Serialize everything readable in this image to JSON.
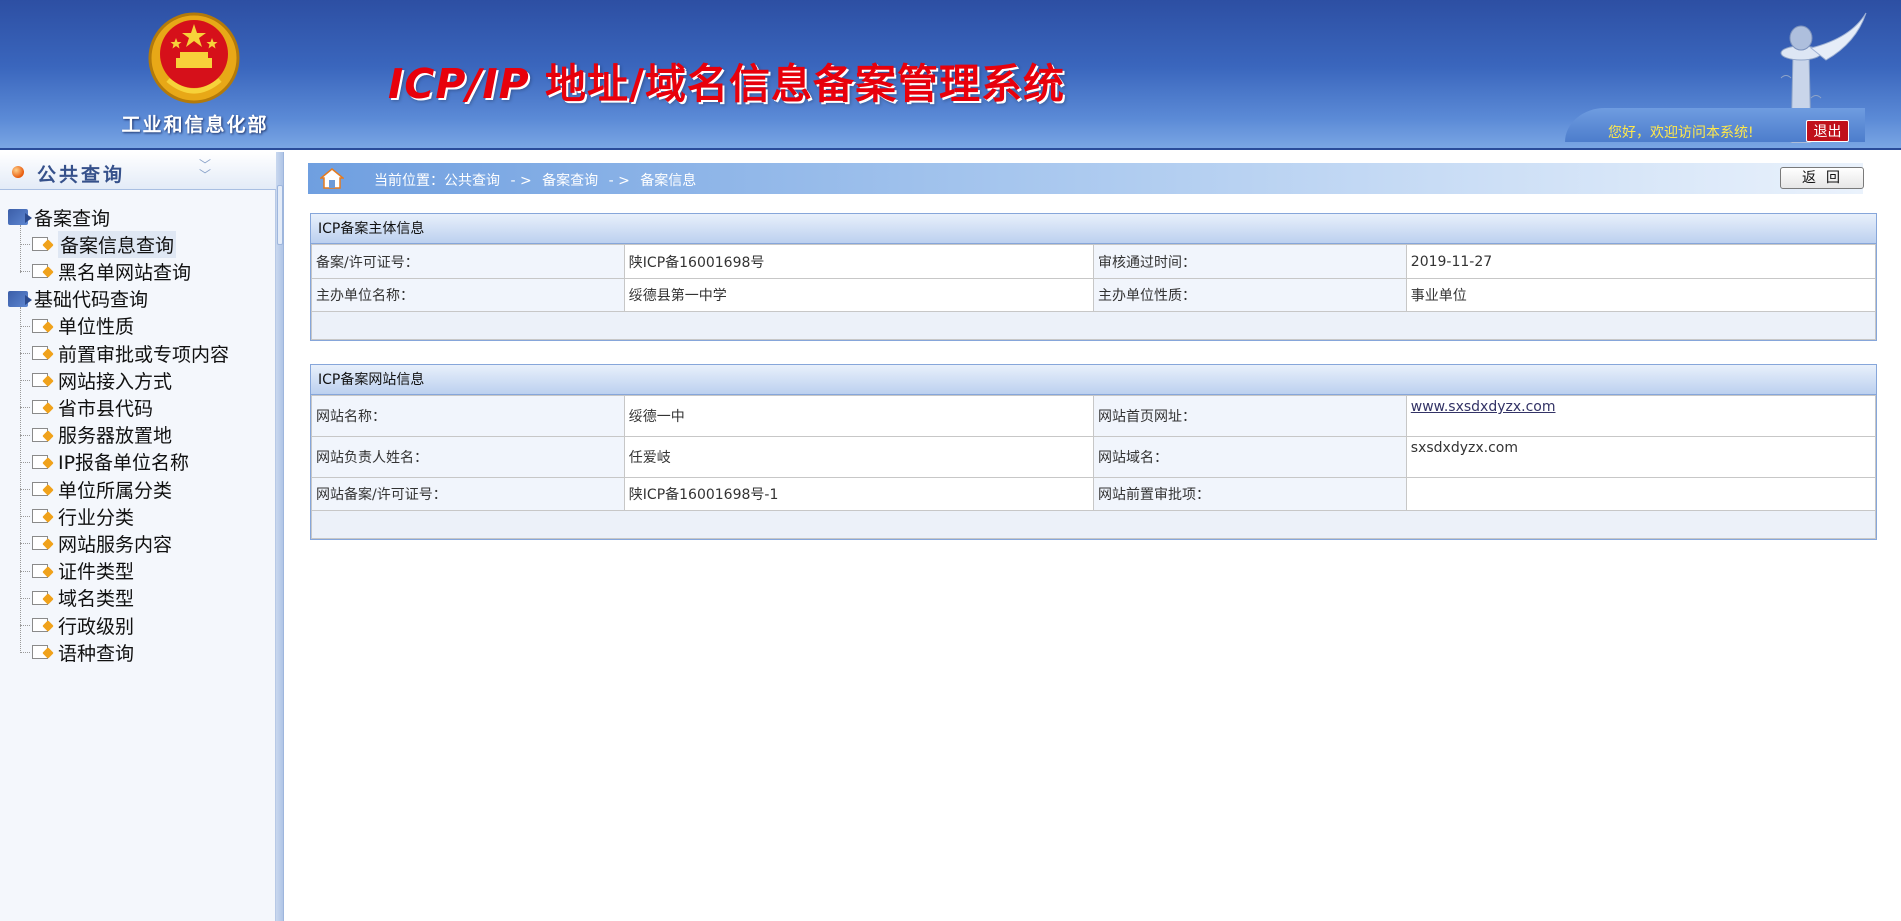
{
  "header": {
    "ministry_name": "工业和信息化部",
    "system_title_latin": "ICP/IP",
    "system_title_cn": "地址/域名信息备案管理系统",
    "welcome_text": "您好，欢迎访问本系统!",
    "logout_label": "退出",
    "title_color": "#e8000b"
  },
  "sidebar": {
    "title": "公共查询",
    "collapse_icon": "double-chevron-down-icon",
    "groups": [
      {
        "label": "备案查询",
        "icon": "folder-icon",
        "items": [
          {
            "label": "备案信息查询",
            "icon": "page-icon",
            "selected": true
          },
          {
            "label": "黑名单网站查询",
            "icon": "page-icon"
          }
        ]
      },
      {
        "label": "基础代码查询",
        "icon": "folder-icon",
        "items": [
          {
            "label": "单位性质",
            "icon": "page-icon"
          },
          {
            "label": "前置审批或专项内容",
            "icon": "page-icon"
          },
          {
            "label": "网站接入方式",
            "icon": "page-icon"
          },
          {
            "label": "省市县代码",
            "icon": "page-icon"
          },
          {
            "label": "服务器放置地",
            "icon": "page-icon"
          },
          {
            "label": "IP报备单位名称",
            "icon": "page-icon"
          },
          {
            "label": "单位所属分类",
            "icon": "page-icon"
          },
          {
            "label": "行业分类",
            "icon": "page-icon"
          },
          {
            "label": "网站服务内容",
            "icon": "page-icon"
          },
          {
            "label": "证件类型",
            "icon": "page-icon"
          },
          {
            "label": "域名类型",
            "icon": "page-icon"
          },
          {
            "label": "行政级别",
            "icon": "page-icon"
          },
          {
            "label": "语种查询",
            "icon": "page-icon"
          }
        ]
      }
    ]
  },
  "breadcrumb": {
    "parts": [
      "当前位置：公共查询",
      "- >",
      "备案查询",
      "- >",
      "备案信息"
    ],
    "back_label": "返回"
  },
  "subject_panel": {
    "title": "ICP备案主体信息",
    "rows": [
      [
        "备案/许可证号：",
        "陕ICP备16001698号",
        "审核通过时间：",
        "2019-11-27"
      ],
      [
        "主办单位名称：",
        "绥德县第一中学",
        "主办单位性质：",
        "事业单位"
      ]
    ]
  },
  "website_panel": {
    "title": "ICP备案网站信息",
    "rows": [
      [
        "网站名称：",
        "绥德一中",
        "网站首页网址：",
        "www.sxsdxdyzx.com"
      ],
      [
        "网站负责人姓名：",
        "任爱岐",
        "网站域名：",
        "sxsdxdyzx.com"
      ],
      [
        "网站备案/许可证号：",
        "陕ICP备16001698号-1",
        "网站前置审批项：",
        ""
      ]
    ]
  }
}
